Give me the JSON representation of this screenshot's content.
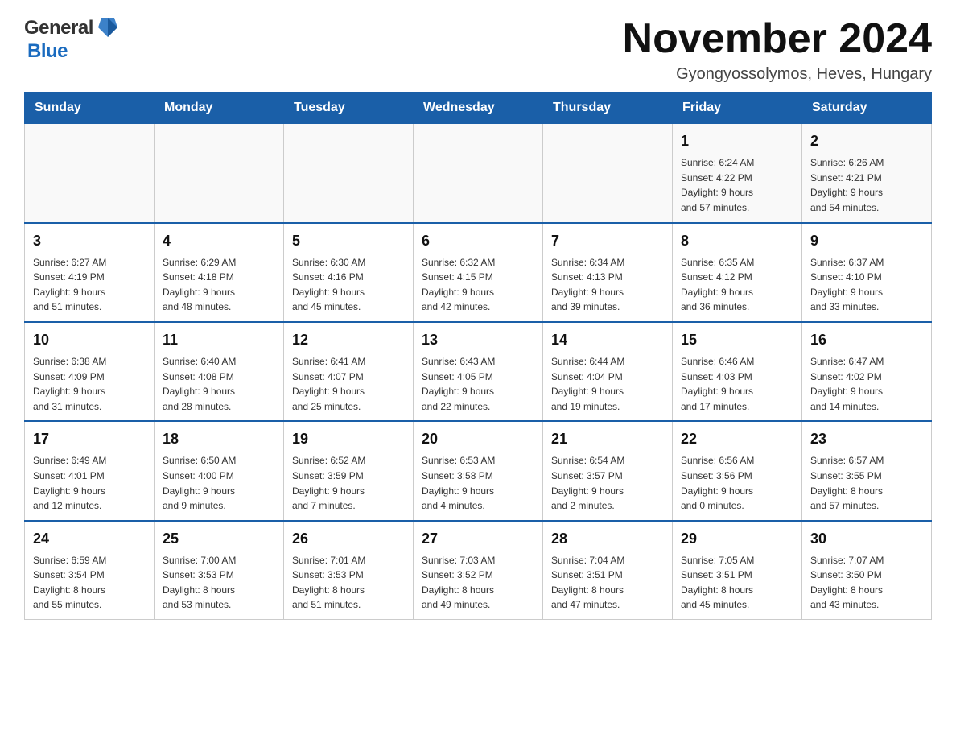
{
  "header": {
    "logo_general": "General",
    "logo_blue": "Blue",
    "title": "November 2024",
    "subtitle": "Gyongyossolymos, Heves, Hungary"
  },
  "weekdays": [
    "Sunday",
    "Monday",
    "Tuesday",
    "Wednesday",
    "Thursday",
    "Friday",
    "Saturday"
  ],
  "weeks": [
    [
      {
        "day": "",
        "info": ""
      },
      {
        "day": "",
        "info": ""
      },
      {
        "day": "",
        "info": ""
      },
      {
        "day": "",
        "info": ""
      },
      {
        "day": "",
        "info": ""
      },
      {
        "day": "1",
        "info": "Sunrise: 6:24 AM\nSunset: 4:22 PM\nDaylight: 9 hours\nand 57 minutes."
      },
      {
        "day": "2",
        "info": "Sunrise: 6:26 AM\nSunset: 4:21 PM\nDaylight: 9 hours\nand 54 minutes."
      }
    ],
    [
      {
        "day": "3",
        "info": "Sunrise: 6:27 AM\nSunset: 4:19 PM\nDaylight: 9 hours\nand 51 minutes."
      },
      {
        "day": "4",
        "info": "Sunrise: 6:29 AM\nSunset: 4:18 PM\nDaylight: 9 hours\nand 48 minutes."
      },
      {
        "day": "5",
        "info": "Sunrise: 6:30 AM\nSunset: 4:16 PM\nDaylight: 9 hours\nand 45 minutes."
      },
      {
        "day": "6",
        "info": "Sunrise: 6:32 AM\nSunset: 4:15 PM\nDaylight: 9 hours\nand 42 minutes."
      },
      {
        "day": "7",
        "info": "Sunrise: 6:34 AM\nSunset: 4:13 PM\nDaylight: 9 hours\nand 39 minutes."
      },
      {
        "day": "8",
        "info": "Sunrise: 6:35 AM\nSunset: 4:12 PM\nDaylight: 9 hours\nand 36 minutes."
      },
      {
        "day": "9",
        "info": "Sunrise: 6:37 AM\nSunset: 4:10 PM\nDaylight: 9 hours\nand 33 minutes."
      }
    ],
    [
      {
        "day": "10",
        "info": "Sunrise: 6:38 AM\nSunset: 4:09 PM\nDaylight: 9 hours\nand 31 minutes."
      },
      {
        "day": "11",
        "info": "Sunrise: 6:40 AM\nSunset: 4:08 PM\nDaylight: 9 hours\nand 28 minutes."
      },
      {
        "day": "12",
        "info": "Sunrise: 6:41 AM\nSunset: 4:07 PM\nDaylight: 9 hours\nand 25 minutes."
      },
      {
        "day": "13",
        "info": "Sunrise: 6:43 AM\nSunset: 4:05 PM\nDaylight: 9 hours\nand 22 minutes."
      },
      {
        "day": "14",
        "info": "Sunrise: 6:44 AM\nSunset: 4:04 PM\nDaylight: 9 hours\nand 19 minutes."
      },
      {
        "day": "15",
        "info": "Sunrise: 6:46 AM\nSunset: 4:03 PM\nDaylight: 9 hours\nand 17 minutes."
      },
      {
        "day": "16",
        "info": "Sunrise: 6:47 AM\nSunset: 4:02 PM\nDaylight: 9 hours\nand 14 minutes."
      }
    ],
    [
      {
        "day": "17",
        "info": "Sunrise: 6:49 AM\nSunset: 4:01 PM\nDaylight: 9 hours\nand 12 minutes."
      },
      {
        "day": "18",
        "info": "Sunrise: 6:50 AM\nSunset: 4:00 PM\nDaylight: 9 hours\nand 9 minutes."
      },
      {
        "day": "19",
        "info": "Sunrise: 6:52 AM\nSunset: 3:59 PM\nDaylight: 9 hours\nand 7 minutes."
      },
      {
        "day": "20",
        "info": "Sunrise: 6:53 AM\nSunset: 3:58 PM\nDaylight: 9 hours\nand 4 minutes."
      },
      {
        "day": "21",
        "info": "Sunrise: 6:54 AM\nSunset: 3:57 PM\nDaylight: 9 hours\nand 2 minutes."
      },
      {
        "day": "22",
        "info": "Sunrise: 6:56 AM\nSunset: 3:56 PM\nDaylight: 9 hours\nand 0 minutes."
      },
      {
        "day": "23",
        "info": "Sunrise: 6:57 AM\nSunset: 3:55 PM\nDaylight: 8 hours\nand 57 minutes."
      }
    ],
    [
      {
        "day": "24",
        "info": "Sunrise: 6:59 AM\nSunset: 3:54 PM\nDaylight: 8 hours\nand 55 minutes."
      },
      {
        "day": "25",
        "info": "Sunrise: 7:00 AM\nSunset: 3:53 PM\nDaylight: 8 hours\nand 53 minutes."
      },
      {
        "day": "26",
        "info": "Sunrise: 7:01 AM\nSunset: 3:53 PM\nDaylight: 8 hours\nand 51 minutes."
      },
      {
        "day": "27",
        "info": "Sunrise: 7:03 AM\nSunset: 3:52 PM\nDaylight: 8 hours\nand 49 minutes."
      },
      {
        "day": "28",
        "info": "Sunrise: 7:04 AM\nSunset: 3:51 PM\nDaylight: 8 hours\nand 47 minutes."
      },
      {
        "day": "29",
        "info": "Sunrise: 7:05 AM\nSunset: 3:51 PM\nDaylight: 8 hours\nand 45 minutes."
      },
      {
        "day": "30",
        "info": "Sunrise: 7:07 AM\nSunset: 3:50 PM\nDaylight: 8 hours\nand 43 minutes."
      }
    ]
  ]
}
